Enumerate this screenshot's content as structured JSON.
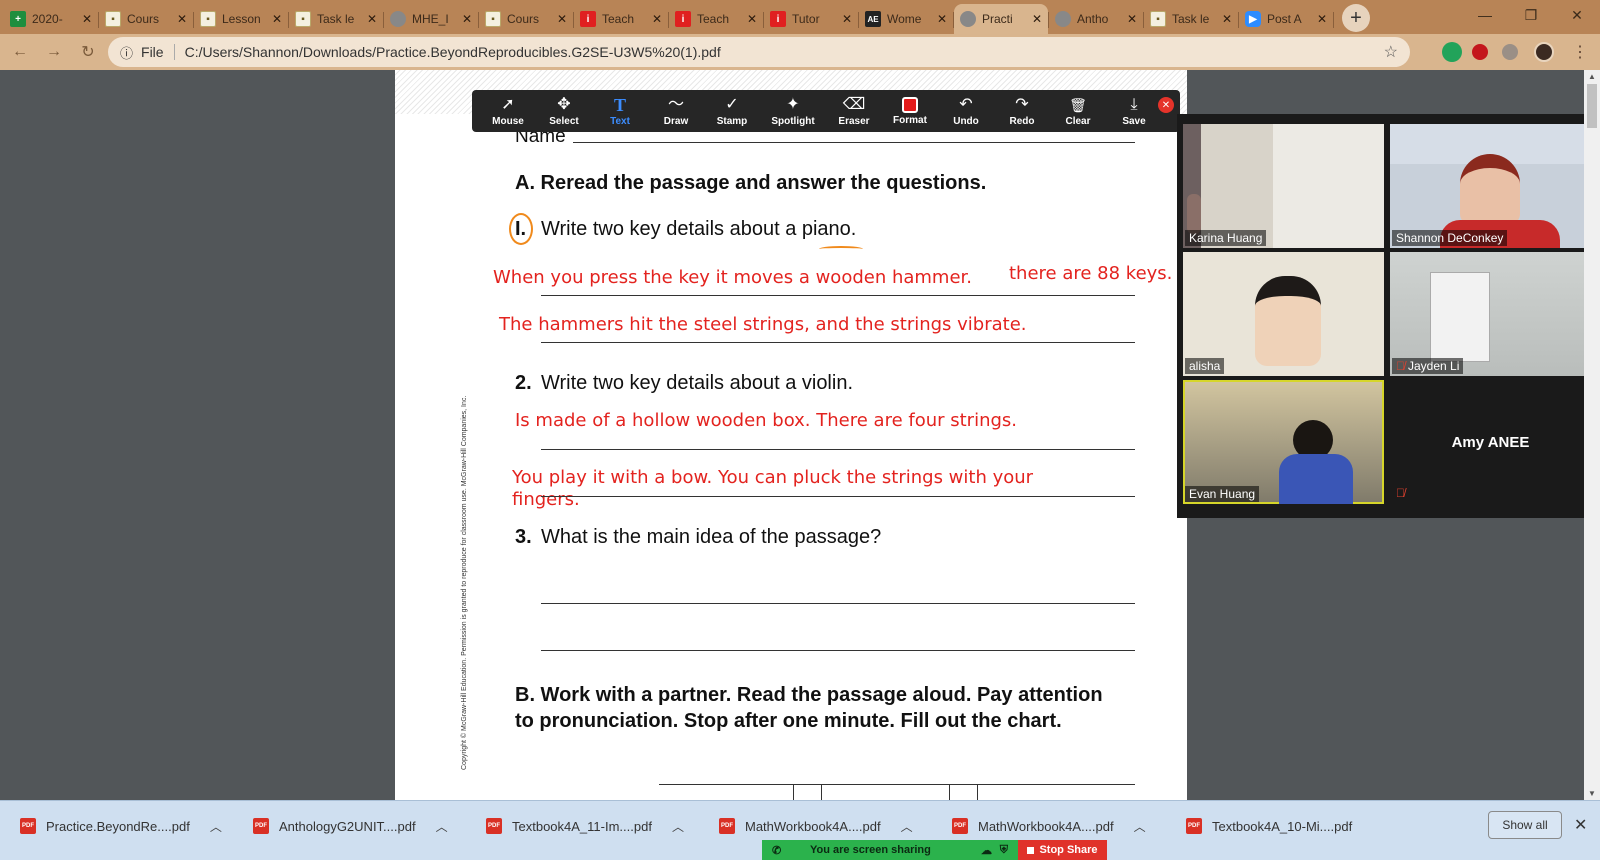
{
  "browser": {
    "tabs": [
      {
        "title": "2020-",
        "icon": "sheets-icon",
        "active": false
      },
      {
        "title": "Cours",
        "icon": "document-icon",
        "active": false
      },
      {
        "title": "Lesson",
        "icon": "document-icon",
        "active": false
      },
      {
        "title": "Task le",
        "icon": "document-icon",
        "active": false
      },
      {
        "title": "MHE_I",
        "icon": "globe-icon",
        "active": false
      },
      {
        "title": "Cours",
        "icon": "document-icon",
        "active": false
      },
      {
        "title": "Teach",
        "icon": "red-i-icon",
        "active": false
      },
      {
        "title": "Teach",
        "icon": "red-i-icon",
        "active": false
      },
      {
        "title": "Tutor",
        "icon": "red-i-icon",
        "active": false
      },
      {
        "title": "Wome",
        "icon": "ae-icon",
        "active": false
      },
      {
        "title": "Practi",
        "icon": "globe-icon",
        "active": true
      },
      {
        "title": "Antho",
        "icon": "globe-icon",
        "active": false
      },
      {
        "title": "Task le",
        "icon": "document-icon",
        "active": false
      },
      {
        "title": "Post A",
        "icon": "zoom-icon",
        "active": false
      }
    ],
    "address": {
      "scheme_label": "File",
      "url": "C:/Users/Shannon/Downloads/Practice.BeyondReproducibles.G2SE-U3W5%20(1).pdf"
    }
  },
  "annotation_toolbar": {
    "tools": [
      {
        "label": "Mouse",
        "icon": "mouse-pointer-icon",
        "glyph": "➚",
        "selected": false
      },
      {
        "label": "Select",
        "icon": "select-move-icon",
        "glyph": "✥",
        "selected": false
      },
      {
        "label": "Text",
        "icon": "text-icon",
        "glyph": "T",
        "selected": true
      },
      {
        "label": "Draw",
        "icon": "draw-icon",
        "glyph": "〜",
        "selected": false
      },
      {
        "label": "Stamp",
        "icon": "stamp-check-icon",
        "glyph": "✓",
        "selected": false
      },
      {
        "label": "Spotlight",
        "icon": "spotlight-icon",
        "glyph": "✦",
        "selected": false
      },
      {
        "label": "Eraser",
        "icon": "eraser-icon",
        "glyph": "⌫",
        "selected": false
      },
      {
        "label": "Format",
        "icon": "format-color-icon",
        "glyph": "",
        "selected": false
      },
      {
        "label": "Undo",
        "icon": "undo-icon",
        "glyph": "↶",
        "selected": false
      },
      {
        "label": "Redo",
        "icon": "redo-icon",
        "glyph": "↷",
        "selected": false
      },
      {
        "label": "Clear",
        "icon": "trash-icon",
        "glyph": "🗑",
        "selected": false
      },
      {
        "label": "Save",
        "icon": "save-download-icon",
        "glyph": "⤓",
        "selected": false
      }
    ],
    "format_color": "#e31b1b"
  },
  "pdf": {
    "name_label": "Name",
    "section_a": "A. Reread the passage and answer the questions.",
    "q1_num": "I.",
    "q1_text": "Write two key details about a piano.",
    "q2_num": "2.",
    "q2_text": "Write two key details about a violin.",
    "q3_num": "3.",
    "q3_text": "What is the main idea of the passage?",
    "section_b": "B. Work with a partner. Read the passage aloud. Pay attention to pronunciation. Stop after one minute. Fill out the chart.",
    "copyright": "Copyright © McGraw-Hill Education. Permission is granted to reproduce for classroom use. McGraw-Hill Companies, Inc.",
    "annotations": {
      "a1": "When you press the key it moves a wooden hammer.",
      "a2": "there are 88 keys.",
      "a3": "The hammers hit the steel strings, and the strings vibrate.",
      "a4": "Is made of a hollow wooden box.  There are four strings.",
      "a5": "You play it with a bow.   You can pluck the strings with your",
      "a6": "fingers."
    },
    "annotation_color": "#e3231f"
  },
  "zoom_gallery": {
    "participants": [
      {
        "name": "Karina Huang",
        "muted": false
      },
      {
        "name": "Shannon DeConkey",
        "muted": false
      },
      {
        "name": "alisha",
        "muted": false
      },
      {
        "name": "Jayden Li",
        "muted": true
      },
      {
        "name": "Evan Huang",
        "muted": false,
        "speaking": true
      },
      {
        "name": "Amy ANEE",
        "muted": true,
        "video_off": true
      }
    ]
  },
  "downloads": {
    "items": [
      "Practice.BeyondRe....pdf",
      "AnthologyG2UNIT....pdf",
      "Textbook4A_11-Im....pdf",
      "MathWorkbook4A....pdf",
      "MathWorkbook4A....pdf",
      "Textbook4A_10-Mi....pdf"
    ],
    "show_all": "Show all"
  },
  "share_banner": {
    "message": "You are screen sharing",
    "stop": "Stop Share"
  }
}
